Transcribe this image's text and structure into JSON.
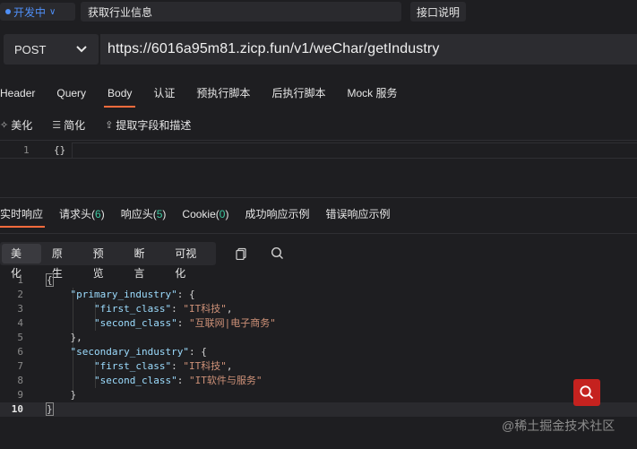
{
  "topbar": {
    "status": "开发中",
    "title": "获取行业信息",
    "doc_button": "接口说明"
  },
  "request": {
    "method": "POST",
    "url": "https://6016a95m81.zicp.fun/v1/weChar/getIndustry"
  },
  "request_tabs": [
    "Header",
    "Query",
    "Body",
    "认证",
    "预执行脚本",
    "后执行脚本",
    "Mock 服务"
  ],
  "request_active_tab": "Body",
  "body_toolbar": {
    "beautify": "美化",
    "simplify": "简化",
    "extract": "提取字段和描述"
  },
  "request_body": {
    "line_number": "1",
    "content": "{}"
  },
  "response_tabs": {
    "realtime": "实时响应",
    "req_headers": "请求头",
    "req_headers_count": "6",
    "resp_headers": "响应头",
    "resp_headers_count": "5",
    "cookie": "Cookie",
    "cookie_count": "0",
    "success_example": "成功响应示例",
    "error_example": "错误响应示例"
  },
  "view_modes": [
    "美化",
    "原生",
    "预览",
    "断言",
    "可视化"
  ],
  "view_active": "美化",
  "response_lines": [
    {
      "n": "1"
    },
    {
      "n": "2",
      "key": "\"primary_industry\""
    },
    {
      "n": "3",
      "key": "\"first_class\"",
      "val": "\"IT科技\""
    },
    {
      "n": "4",
      "key": "\"second_class\"",
      "val": "\"互联网|电子商务\""
    },
    {
      "n": "5"
    },
    {
      "n": "6",
      "key": "\"secondary_industry\""
    },
    {
      "n": "7",
      "key": "\"first_class\"",
      "val": "\"IT科技\""
    },
    {
      "n": "8",
      "key": "\"second_class\"",
      "val": "\"IT软件与服务\""
    },
    {
      "n": "9"
    },
    {
      "n": "10"
    }
  ],
  "watermark": "@稀土掘金技术社区",
  "colors": {
    "accent": "#ff6b3d",
    "status_blue": "#4f8ff7",
    "count_green": "#3ec8a0",
    "json_key": "#9cdcfe",
    "json_string": "#ce9178",
    "fab_red": "#c5221f"
  },
  "icons": {
    "beautify": "magic-wand-icon",
    "simplify": "lines-icon",
    "extract": "upload-icon",
    "copy": "copy-icon",
    "search": "search-icon",
    "fab": "search-icon"
  }
}
